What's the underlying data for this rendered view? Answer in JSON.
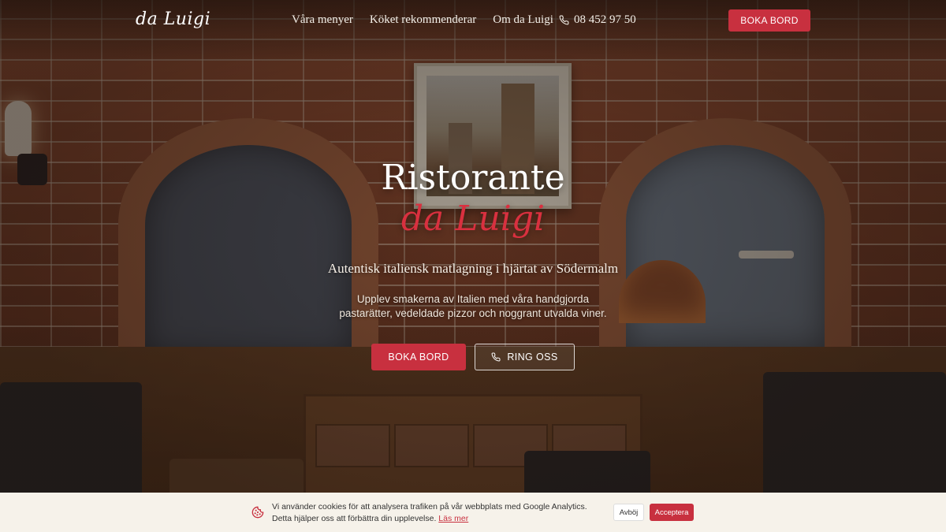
{
  "brand": {
    "logo": "da Luigi"
  },
  "nav": {
    "items": [
      "Våra menyer",
      "Köket rekommenderar",
      "Om da Luigi"
    ],
    "phone": "08 452 97 50",
    "phone_icon": "phone-icon",
    "cta": "BOKA BORD"
  },
  "hero": {
    "title": "Ristorante",
    "title_script": "da Luigi",
    "tagline": "Autentisk italiensk matlagning i hjärtat av Södermalm",
    "description": "Upplev smakerna av Italien med våra handgjorda pastarätter, vedeldade pizzor och noggrant utvalda viner.",
    "primary_button": "BOKA BORD",
    "secondary_button": "RING OSS"
  },
  "cookie": {
    "icon": "cookie-icon",
    "text": "Vi använder cookies för att analysera trafiken på vår webbplats med Google Analytics. Detta hjälper oss att förbättra din upplevelse.",
    "link": "Läs mer",
    "decline": "Avböj",
    "accept": "Acceptera"
  },
  "colors": {
    "accent": "#c8303f",
    "cookie_bar": "#f6f2ea",
    "text_light": "#ffffff"
  }
}
